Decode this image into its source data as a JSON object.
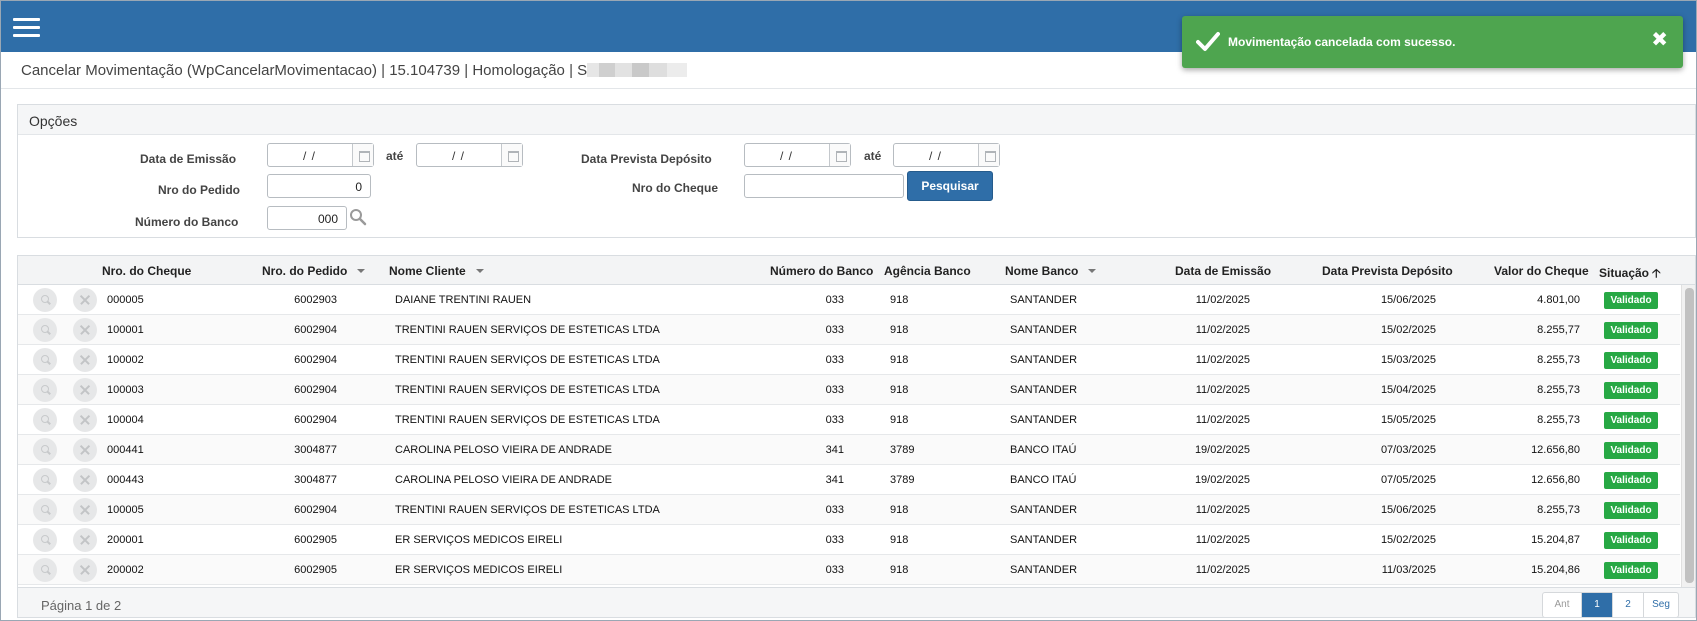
{
  "header": {
    "page_title": "Cancelar Movimentação (WpCancelarMovimentacao) | 15.104739 | Homologação | S"
  },
  "toast": {
    "message": "Movimentação cancelada com sucesso.",
    "close_glyph": "✖",
    "color": "#4ea54f"
  },
  "options": {
    "title": "Opções",
    "data_emissao_label": "Data de Emissão",
    "data_emissao_de": "/ /",
    "ate_label": "até",
    "data_emissao_ate": "/ /",
    "data_prevista_label": "Data Prevista Depósito",
    "data_prevista_de": "/ /",
    "data_prevista_ate": "/ /",
    "nro_pedido_label": "Nro do Pedido",
    "nro_pedido_value": "0",
    "nro_cheque_label": "Nro do Cheque",
    "nro_cheque_value": "",
    "numero_banco_label": "Número do Banco",
    "numero_banco_value": "000",
    "search_button": "Pesquisar"
  },
  "grid": {
    "columns": {
      "nro_cheque": "Nro. do Cheque",
      "nro_pedido": "Nro. do Pedido",
      "nome_cliente": "Nome Cliente",
      "numero_banco": "Número do Banco",
      "agencia": "Agência Banco",
      "nome_banco": "Nome Banco",
      "data_emissao": "Data de Emissão",
      "data_prevista": "Data Prevista Depósito",
      "valor": "Valor do Cheque",
      "situacao": "Situação"
    },
    "sort_up_glyph": "🡡",
    "rows": [
      {
        "cheque": "000005",
        "pedido": "6002903",
        "cliente": "DAIANE TRENTINI RAUEN",
        "banco": "033",
        "agencia": "918",
        "nome_banco": "SANTANDER",
        "emissao": "11/02/2025",
        "prevista": "15/06/2025",
        "valor": "4.801,00",
        "situacao": "Validado"
      },
      {
        "cheque": "100001",
        "pedido": "6002904",
        "cliente": "TRENTINI RAUEN SERVIÇOS DE ESTETICAS LTDA",
        "banco": "033",
        "agencia": "918",
        "nome_banco": "SANTANDER",
        "emissao": "11/02/2025",
        "prevista": "15/02/2025",
        "valor": "8.255,77",
        "situacao": "Validado"
      },
      {
        "cheque": "100002",
        "pedido": "6002904",
        "cliente": "TRENTINI RAUEN SERVIÇOS DE ESTETICAS LTDA",
        "banco": "033",
        "agencia": "918",
        "nome_banco": "SANTANDER",
        "emissao": "11/02/2025",
        "prevista": "15/03/2025",
        "valor": "8.255,73",
        "situacao": "Validado"
      },
      {
        "cheque": "100003",
        "pedido": "6002904",
        "cliente": "TRENTINI RAUEN SERVIÇOS DE ESTETICAS LTDA",
        "banco": "033",
        "agencia": "918",
        "nome_banco": "SANTANDER",
        "emissao": "11/02/2025",
        "prevista": "15/04/2025",
        "valor": "8.255,73",
        "situacao": "Validado"
      },
      {
        "cheque": "100004",
        "pedido": "6002904",
        "cliente": "TRENTINI RAUEN SERVIÇOS DE ESTETICAS LTDA",
        "banco": "033",
        "agencia": "918",
        "nome_banco": "SANTANDER",
        "emissao": "11/02/2025",
        "prevista": "15/05/2025",
        "valor": "8.255,73",
        "situacao": "Validado"
      },
      {
        "cheque": "000441",
        "pedido": "3004877",
        "cliente": "CAROLINA PELOSO VIEIRA DE ANDRADE",
        "banco": "341",
        "agencia": "3789",
        "nome_banco": "BANCO ITAÚ",
        "emissao": "19/02/2025",
        "prevista": "07/03/2025",
        "valor": "12.656,80",
        "situacao": "Validado"
      },
      {
        "cheque": "000443",
        "pedido": "3004877",
        "cliente": "CAROLINA PELOSO VIEIRA DE ANDRADE",
        "banco": "341",
        "agencia": "3789",
        "nome_banco": "BANCO ITAÚ",
        "emissao": "19/02/2025",
        "prevista": "07/05/2025",
        "valor": "12.656,80",
        "situacao": "Validado"
      },
      {
        "cheque": "100005",
        "pedido": "6002904",
        "cliente": "TRENTINI RAUEN SERVIÇOS DE ESTETICAS LTDA",
        "banco": "033",
        "agencia": "918",
        "nome_banco": "SANTANDER",
        "emissao": "11/02/2025",
        "prevista": "15/06/2025",
        "valor": "8.255,73",
        "situacao": "Validado"
      },
      {
        "cheque": "200001",
        "pedido": "6002905",
        "cliente": "ER SERVIÇOS MEDICOS EIRELI",
        "banco": "033",
        "agencia": "918",
        "nome_banco": "SANTANDER",
        "emissao": "11/02/2025",
        "prevista": "15/02/2025",
        "valor": "15.204,87",
        "situacao": "Validado"
      },
      {
        "cheque": "200002",
        "pedido": "6002905",
        "cliente": "ER SERVIÇOS MEDICOS EIRELI",
        "banco": "033",
        "agencia": "918",
        "nome_banco": "SANTANDER",
        "emissao": "11/02/2025",
        "prevista": "11/03/2025",
        "valor": "15.204,86",
        "situacao": "Validado"
      }
    ],
    "footer": {
      "page_info": "Página 1 de 2",
      "prev": "Ant",
      "pages": [
        "1",
        "2"
      ],
      "next": "Seg",
      "current_page": "1"
    }
  },
  "colors": {
    "topbar": "#2f6ea8",
    "status_validado": "#27a844"
  }
}
